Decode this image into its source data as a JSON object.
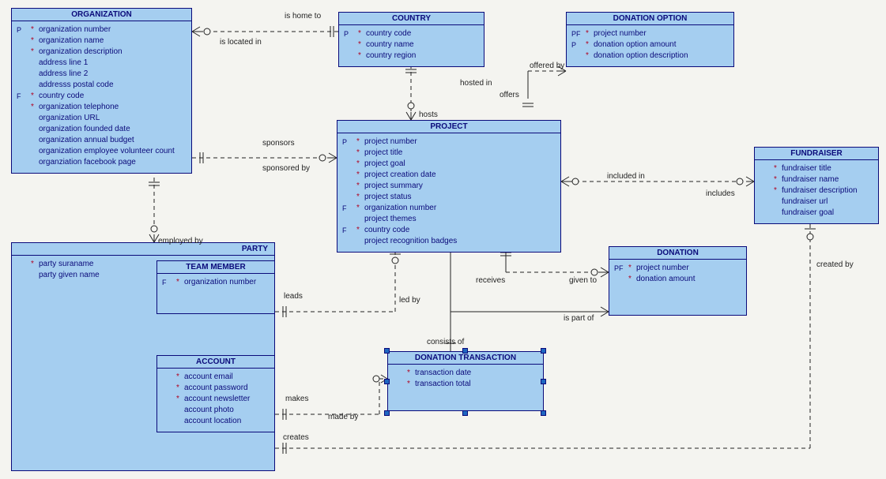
{
  "entities": {
    "organization": {
      "title": "ORGANIZATION",
      "attrs": [
        {
          "key": "P",
          "req": "*",
          "name": "organization number"
        },
        {
          "key": "",
          "req": "*",
          "name": "organization name"
        },
        {
          "key": "",
          "req": "*",
          "name": "organization description"
        },
        {
          "key": "",
          "req": "",
          "name": "address line 1"
        },
        {
          "key": "",
          "req": "",
          "name": "address line 2"
        },
        {
          "key": "",
          "req": "",
          "name": "addresss postal code"
        },
        {
          "key": "F",
          "req": "*",
          "name": "country code"
        },
        {
          "key": "",
          "req": "*",
          "name": "organization telephone"
        },
        {
          "key": "",
          "req": "",
          "name": "organization URL"
        },
        {
          "key": "",
          "req": "",
          "name": "organization founded date"
        },
        {
          "key": "",
          "req": "",
          "name": "organization annual budget"
        },
        {
          "key": "",
          "req": "",
          "name": "organization employee volunteer count"
        },
        {
          "key": "",
          "req": "",
          "name": "organziation facebook page"
        }
      ]
    },
    "country": {
      "title": "COUNTRY",
      "attrs": [
        {
          "key": "P",
          "req": "*",
          "name": "country code"
        },
        {
          "key": "",
          "req": "*",
          "name": "country name"
        },
        {
          "key": "",
          "req": "*",
          "name": "country region"
        }
      ]
    },
    "donation_option": {
      "title": "DONATION OPTION",
      "attrs": [
        {
          "key": "PF",
          "req": "*",
          "name": "project number"
        },
        {
          "key": "P",
          "req": "*",
          "name": "donation option amount"
        },
        {
          "key": "",
          "req": "*",
          "name": "donation option description"
        }
      ]
    },
    "project": {
      "title": "PROJECT",
      "attrs": [
        {
          "key": "P",
          "req": "*",
          "name": "project number"
        },
        {
          "key": "",
          "req": "*",
          "name": "project title"
        },
        {
          "key": "",
          "req": "*",
          "name": "project goal"
        },
        {
          "key": "",
          "req": "*",
          "name": "project creation date"
        },
        {
          "key": "",
          "req": "*",
          "name": "project summary"
        },
        {
          "key": "",
          "req": "*",
          "name": "project status"
        },
        {
          "key": "F",
          "req": "*",
          "name": "organization number"
        },
        {
          "key": "",
          "req": "",
          "name": "project themes"
        },
        {
          "key": "F",
          "req": "*",
          "name": "country code"
        },
        {
          "key": "",
          "req": "",
          "name": "project recognition badges"
        }
      ]
    },
    "fundraiser": {
      "title": "FUNDRAISER",
      "attrs": [
        {
          "key": "",
          "req": "*",
          "name": "fundraiser title"
        },
        {
          "key": "",
          "req": "*",
          "name": "fundraiser name"
        },
        {
          "key": "",
          "req": "*",
          "name": "fundraiser description"
        },
        {
          "key": "",
          "req": "",
          "name": "fundraiser url"
        },
        {
          "key": "",
          "req": "",
          "name": "fundraiser goal"
        }
      ]
    },
    "party": {
      "title": "PARTY",
      "attrs": [
        {
          "key": "",
          "req": "*",
          "name": "party suraname"
        },
        {
          "key": "",
          "req": "",
          "name": "party given name"
        }
      ]
    },
    "team_member": {
      "title": "TEAM MEMBER",
      "attrs": [
        {
          "key": "F",
          "req": "*",
          "name": "organization number"
        }
      ]
    },
    "account": {
      "title": "ACCOUNT",
      "attrs": [
        {
          "key": "",
          "req": "*",
          "name": "account email"
        },
        {
          "key": "",
          "req": "*",
          "name": "account password"
        },
        {
          "key": "",
          "req": "*",
          "name": "account newsletter"
        },
        {
          "key": "",
          "req": "",
          "name": "account photo"
        },
        {
          "key": "",
          "req": "",
          "name": "account location"
        }
      ]
    },
    "donation": {
      "title": "DONATION",
      "attrs": [
        {
          "key": "PF",
          "req": "*",
          "name": "project number"
        },
        {
          "key": "",
          "req": "*",
          "name": "donation amount"
        }
      ]
    },
    "donation_transaction": {
      "title": "DONATION TRANSACTION",
      "attrs": [
        {
          "key": "",
          "req": "*",
          "name": "transaction date"
        },
        {
          "key": "",
          "req": "*",
          "name": "transaction total"
        }
      ]
    }
  },
  "labels": {
    "is_home_to": "is home to",
    "is_located_in": "is located in",
    "sponsors": "sponsors",
    "sponsored_by": "sponsored by",
    "hosted_in": "hosted in",
    "hosts": "hosts",
    "offers": "offers",
    "offered_by": "offered by",
    "included_in": "included in",
    "includes": "includes",
    "employed_by": "employed by",
    "leads": "leads",
    "led_by": "led by",
    "receives": "receives",
    "given_to": "given to",
    "is_part_of": "is part of",
    "consists_of": "consists of",
    "makes": "makes",
    "made_by": "made by",
    "creates": "creates",
    "created_by": "created by"
  }
}
